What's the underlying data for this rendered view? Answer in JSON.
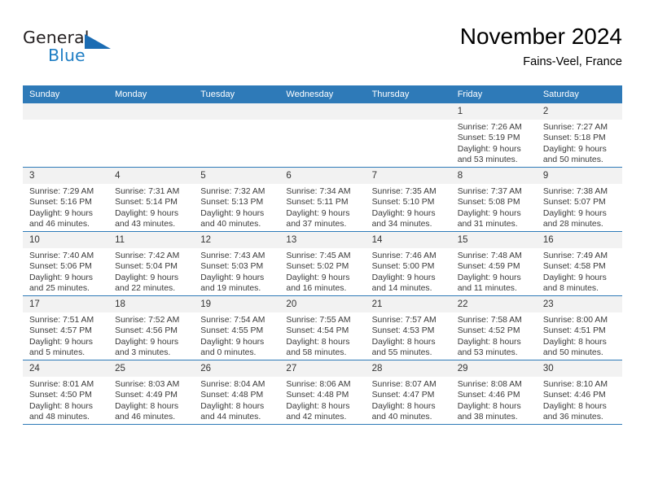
{
  "brand": {
    "name_top": "General",
    "name_bottom": "Blue",
    "triangle_icon": "triangle-icon",
    "color_primary": "#1b6cb3",
    "color_text": "#231f20"
  },
  "header": {
    "month_title": "November 2024",
    "location": "Fains-Veel, France"
  },
  "theme": {
    "header_blue": "#2e7ab8",
    "daynum_gray": "#f2f2f2",
    "body_text": "#3a3a3a"
  },
  "weekday_headers": [
    "Sunday",
    "Monday",
    "Tuesday",
    "Wednesday",
    "Thursday",
    "Friday",
    "Saturday"
  ],
  "weeks": [
    [
      {
        "day": "",
        "sunrise": "",
        "sunset": "",
        "daylight_line1": "",
        "daylight_line2": ""
      },
      {
        "day": "",
        "sunrise": "",
        "sunset": "",
        "daylight_line1": "",
        "daylight_line2": ""
      },
      {
        "day": "",
        "sunrise": "",
        "sunset": "",
        "daylight_line1": "",
        "daylight_line2": ""
      },
      {
        "day": "",
        "sunrise": "",
        "sunset": "",
        "daylight_line1": "",
        "daylight_line2": ""
      },
      {
        "day": "",
        "sunrise": "",
        "sunset": "",
        "daylight_line1": "",
        "daylight_line2": ""
      },
      {
        "day": "1",
        "sunrise": "Sunrise: 7:26 AM",
        "sunset": "Sunset: 5:19 PM",
        "daylight_line1": "Daylight: 9 hours",
        "daylight_line2": "and 53 minutes."
      },
      {
        "day": "2",
        "sunrise": "Sunrise: 7:27 AM",
        "sunset": "Sunset: 5:18 PM",
        "daylight_line1": "Daylight: 9 hours",
        "daylight_line2": "and 50 minutes."
      }
    ],
    [
      {
        "day": "3",
        "sunrise": "Sunrise: 7:29 AM",
        "sunset": "Sunset: 5:16 PM",
        "daylight_line1": "Daylight: 9 hours",
        "daylight_line2": "and 46 minutes."
      },
      {
        "day": "4",
        "sunrise": "Sunrise: 7:31 AM",
        "sunset": "Sunset: 5:14 PM",
        "daylight_line1": "Daylight: 9 hours",
        "daylight_line2": "and 43 minutes."
      },
      {
        "day": "5",
        "sunrise": "Sunrise: 7:32 AM",
        "sunset": "Sunset: 5:13 PM",
        "daylight_line1": "Daylight: 9 hours",
        "daylight_line2": "and 40 minutes."
      },
      {
        "day": "6",
        "sunrise": "Sunrise: 7:34 AM",
        "sunset": "Sunset: 5:11 PM",
        "daylight_line1": "Daylight: 9 hours",
        "daylight_line2": "and 37 minutes."
      },
      {
        "day": "7",
        "sunrise": "Sunrise: 7:35 AM",
        "sunset": "Sunset: 5:10 PM",
        "daylight_line1": "Daylight: 9 hours",
        "daylight_line2": "and 34 minutes."
      },
      {
        "day": "8",
        "sunrise": "Sunrise: 7:37 AM",
        "sunset": "Sunset: 5:08 PM",
        "daylight_line1": "Daylight: 9 hours",
        "daylight_line2": "and 31 minutes."
      },
      {
        "day": "9",
        "sunrise": "Sunrise: 7:38 AM",
        "sunset": "Sunset: 5:07 PM",
        "daylight_line1": "Daylight: 9 hours",
        "daylight_line2": "and 28 minutes."
      }
    ],
    [
      {
        "day": "10",
        "sunrise": "Sunrise: 7:40 AM",
        "sunset": "Sunset: 5:06 PM",
        "daylight_line1": "Daylight: 9 hours",
        "daylight_line2": "and 25 minutes."
      },
      {
        "day": "11",
        "sunrise": "Sunrise: 7:42 AM",
        "sunset": "Sunset: 5:04 PM",
        "daylight_line1": "Daylight: 9 hours",
        "daylight_line2": "and 22 minutes."
      },
      {
        "day": "12",
        "sunrise": "Sunrise: 7:43 AM",
        "sunset": "Sunset: 5:03 PM",
        "daylight_line1": "Daylight: 9 hours",
        "daylight_line2": "and 19 minutes."
      },
      {
        "day": "13",
        "sunrise": "Sunrise: 7:45 AM",
        "sunset": "Sunset: 5:02 PM",
        "daylight_line1": "Daylight: 9 hours",
        "daylight_line2": "and 16 minutes."
      },
      {
        "day": "14",
        "sunrise": "Sunrise: 7:46 AM",
        "sunset": "Sunset: 5:00 PM",
        "daylight_line1": "Daylight: 9 hours",
        "daylight_line2": "and 14 minutes."
      },
      {
        "day": "15",
        "sunrise": "Sunrise: 7:48 AM",
        "sunset": "Sunset: 4:59 PM",
        "daylight_line1": "Daylight: 9 hours",
        "daylight_line2": "and 11 minutes."
      },
      {
        "day": "16",
        "sunrise": "Sunrise: 7:49 AM",
        "sunset": "Sunset: 4:58 PM",
        "daylight_line1": "Daylight: 9 hours",
        "daylight_line2": "and 8 minutes."
      }
    ],
    [
      {
        "day": "17",
        "sunrise": "Sunrise: 7:51 AM",
        "sunset": "Sunset: 4:57 PM",
        "daylight_line1": "Daylight: 9 hours",
        "daylight_line2": "and 5 minutes."
      },
      {
        "day": "18",
        "sunrise": "Sunrise: 7:52 AM",
        "sunset": "Sunset: 4:56 PM",
        "daylight_line1": "Daylight: 9 hours",
        "daylight_line2": "and 3 minutes."
      },
      {
        "day": "19",
        "sunrise": "Sunrise: 7:54 AM",
        "sunset": "Sunset: 4:55 PM",
        "daylight_line1": "Daylight: 9 hours",
        "daylight_line2": "and 0 minutes."
      },
      {
        "day": "20",
        "sunrise": "Sunrise: 7:55 AM",
        "sunset": "Sunset: 4:54 PM",
        "daylight_line1": "Daylight: 8 hours",
        "daylight_line2": "and 58 minutes."
      },
      {
        "day": "21",
        "sunrise": "Sunrise: 7:57 AM",
        "sunset": "Sunset: 4:53 PM",
        "daylight_line1": "Daylight: 8 hours",
        "daylight_line2": "and 55 minutes."
      },
      {
        "day": "22",
        "sunrise": "Sunrise: 7:58 AM",
        "sunset": "Sunset: 4:52 PM",
        "daylight_line1": "Daylight: 8 hours",
        "daylight_line2": "and 53 minutes."
      },
      {
        "day": "23",
        "sunrise": "Sunrise: 8:00 AM",
        "sunset": "Sunset: 4:51 PM",
        "daylight_line1": "Daylight: 8 hours",
        "daylight_line2": "and 50 minutes."
      }
    ],
    [
      {
        "day": "24",
        "sunrise": "Sunrise: 8:01 AM",
        "sunset": "Sunset: 4:50 PM",
        "daylight_line1": "Daylight: 8 hours",
        "daylight_line2": "and 48 minutes."
      },
      {
        "day": "25",
        "sunrise": "Sunrise: 8:03 AM",
        "sunset": "Sunset: 4:49 PM",
        "daylight_line1": "Daylight: 8 hours",
        "daylight_line2": "and 46 minutes."
      },
      {
        "day": "26",
        "sunrise": "Sunrise: 8:04 AM",
        "sunset": "Sunset: 4:48 PM",
        "daylight_line1": "Daylight: 8 hours",
        "daylight_line2": "and 44 minutes."
      },
      {
        "day": "27",
        "sunrise": "Sunrise: 8:06 AM",
        "sunset": "Sunset: 4:48 PM",
        "daylight_line1": "Daylight: 8 hours",
        "daylight_line2": "and 42 minutes."
      },
      {
        "day": "28",
        "sunrise": "Sunrise: 8:07 AM",
        "sunset": "Sunset: 4:47 PM",
        "daylight_line1": "Daylight: 8 hours",
        "daylight_line2": "and 40 minutes."
      },
      {
        "day": "29",
        "sunrise": "Sunrise: 8:08 AM",
        "sunset": "Sunset: 4:46 PM",
        "daylight_line1": "Daylight: 8 hours",
        "daylight_line2": "and 38 minutes."
      },
      {
        "day": "30",
        "sunrise": "Sunrise: 8:10 AM",
        "sunset": "Sunset: 4:46 PM",
        "daylight_line1": "Daylight: 8 hours",
        "daylight_line2": "and 36 minutes."
      }
    ]
  ]
}
